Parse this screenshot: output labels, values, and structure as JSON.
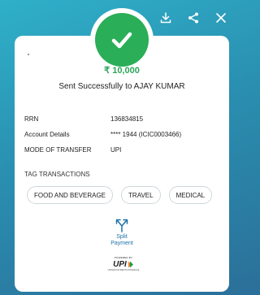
{
  "toolbar": {
    "download_icon": "download-icon",
    "share_icon": "share-icon",
    "close_icon": "close-icon"
  },
  "status": {
    "icon": "check-icon",
    "color": "#2aae57"
  },
  "transaction": {
    "amount": "₹ 10,000",
    "message": "Sent Successfully to  AJAY KUMAR"
  },
  "details": [
    {
      "label": "RRN",
      "value": "136834815"
    },
    {
      "label": "Account Details",
      "value": "**** 1944 (ICIC0003466)"
    },
    {
      "label": "MODE OF TRANSFER",
      "value": "UPI"
    }
  ],
  "tags": {
    "title": "TAG TRANSACTIONS",
    "items": [
      "FOOD AND BEVERAGE",
      "TRAVEL",
      "MEDICAL"
    ]
  },
  "split": {
    "label_line1": "Split",
    "label_line2": "Payment",
    "icon": "split-icon"
  },
  "upi": {
    "powered": "POWERED BY",
    "logo": "UPI",
    "tagline": "UNIFIED PAYMENTS INTERFACE"
  }
}
